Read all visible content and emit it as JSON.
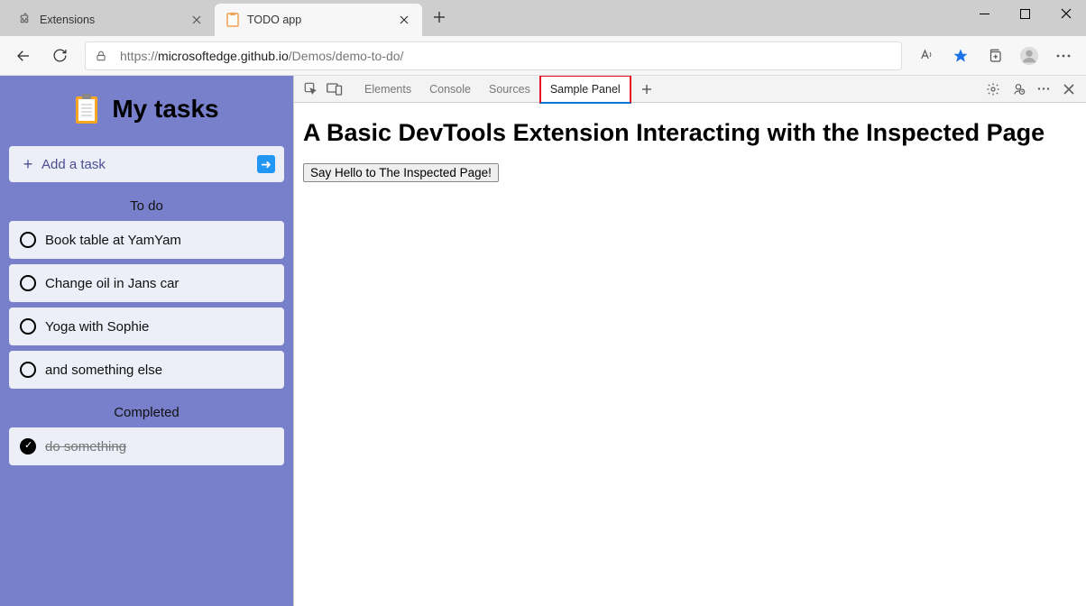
{
  "browser": {
    "tabs": [
      {
        "title": "Extensions",
        "icon": "extension"
      },
      {
        "title": "TODO app",
        "icon": "todo"
      }
    ],
    "url_prefix": "https://",
    "url_host": "microsoftedge.github.io",
    "url_path": "/Demos/demo-to-do/"
  },
  "page": {
    "heading": "My tasks",
    "add_label": "Add a task",
    "sections": {
      "todo_label": "To do",
      "completed_label": "Completed"
    },
    "todo": [
      "Book table at YamYam",
      "Change oil in Jans car",
      "Yoga with Sophie",
      "and something else"
    ],
    "completed": [
      "do something"
    ]
  },
  "devtools": {
    "tabs": [
      "Elements",
      "Console",
      "Sources",
      "Sample Panel"
    ],
    "active_tab": "Sample Panel",
    "panel_heading": "A Basic DevTools Extension Interacting with the Inspected Page",
    "button_label": "Say Hello to The Inspected Page!"
  }
}
